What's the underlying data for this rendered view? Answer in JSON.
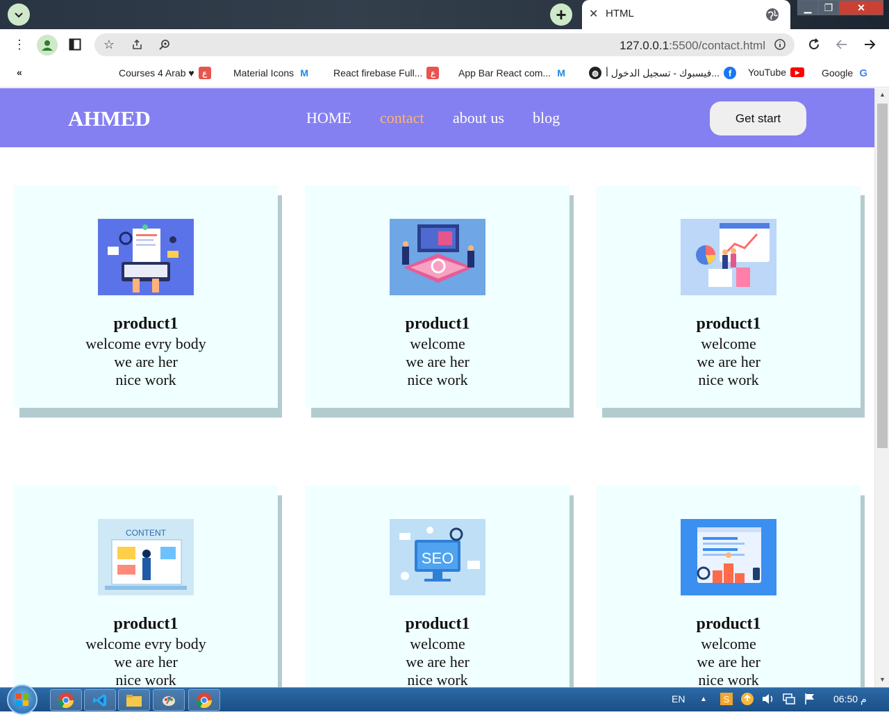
{
  "browser": {
    "tab_title": "HTML",
    "url_host": "127.0.0.1",
    "url_rest": ":5500/contact.html",
    "bookmarks_overflow": "«",
    "bookmarks": [
      {
        "label": "Courses 4 Arab ♥",
        "icon": "courses-icon",
        "color": "#e8544e"
      },
      {
        "label": "Material Icons",
        "icon": "mui-icon",
        "color": "#1e88e5"
      },
      {
        "label": "React firebase Full...",
        "icon": "react-firebase-icon",
        "color": "#e8544e"
      },
      {
        "label": "App Bar React com...",
        "icon": "mui-icon",
        "color": "#1e88e5"
      },
      {
        "label": "فيسبوك - تسجيل الدخول أ...",
        "icon": "facebook-icon",
        "color": "#1877f2"
      },
      {
        "label": "YouTube",
        "icon": "youtube-icon",
        "color": "#ff0000"
      },
      {
        "label": "Google",
        "icon": "google-icon",
        "color": "#4285f4"
      }
    ]
  },
  "page": {
    "brand": "AHMED",
    "nav": [
      {
        "label": "HOME",
        "active": false
      },
      {
        "label": "contact",
        "active": true
      },
      {
        "label": "about us",
        "active": false
      },
      {
        "label": "blog",
        "active": false
      }
    ],
    "cta_label": "Get start",
    "colors": {
      "navbar": "#8580f2",
      "nav_active": "#ffb46a",
      "card_bg": "#f0ffff",
      "card_shadow": "#b3cbcf"
    },
    "cards": [
      {
        "title": "product1",
        "lines": [
          "welcome evry body",
          "we are her",
          "nice work"
        ],
        "image": "web-development-illustration"
      },
      {
        "title": "product1",
        "lines": [
          "welcome",
          "we are her",
          "nice work"
        ],
        "image": "data-analytics-illustration"
      },
      {
        "title": "product1",
        "lines": [
          "welcome",
          "we are her",
          "nice work"
        ],
        "image": "business-charts-illustration"
      },
      {
        "title": "product1",
        "lines": [
          "welcome evry body",
          "we are her",
          "nice work"
        ],
        "image": "content-illustration"
      },
      {
        "title": "product1",
        "lines": [
          "welcome",
          "we are her",
          "nice work"
        ],
        "image": "seo-illustration"
      },
      {
        "title": "product1",
        "lines": [
          "welcome",
          "we are her",
          "nice work"
        ],
        "image": "ranking-illustration"
      }
    ]
  },
  "illustration_text": {
    "content": "CONTENT",
    "seo": "SEO"
  },
  "taskbar": {
    "language": "EN",
    "time": "06:50 م"
  }
}
